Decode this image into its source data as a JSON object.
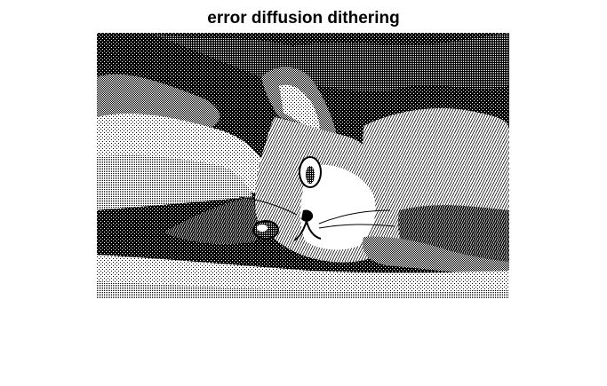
{
  "figure": {
    "title": "error diffusion dithering"
  },
  "image": {
    "subject": "cat",
    "colors": {
      "ink": "#000000",
      "paper": "#ffffff"
    }
  }
}
